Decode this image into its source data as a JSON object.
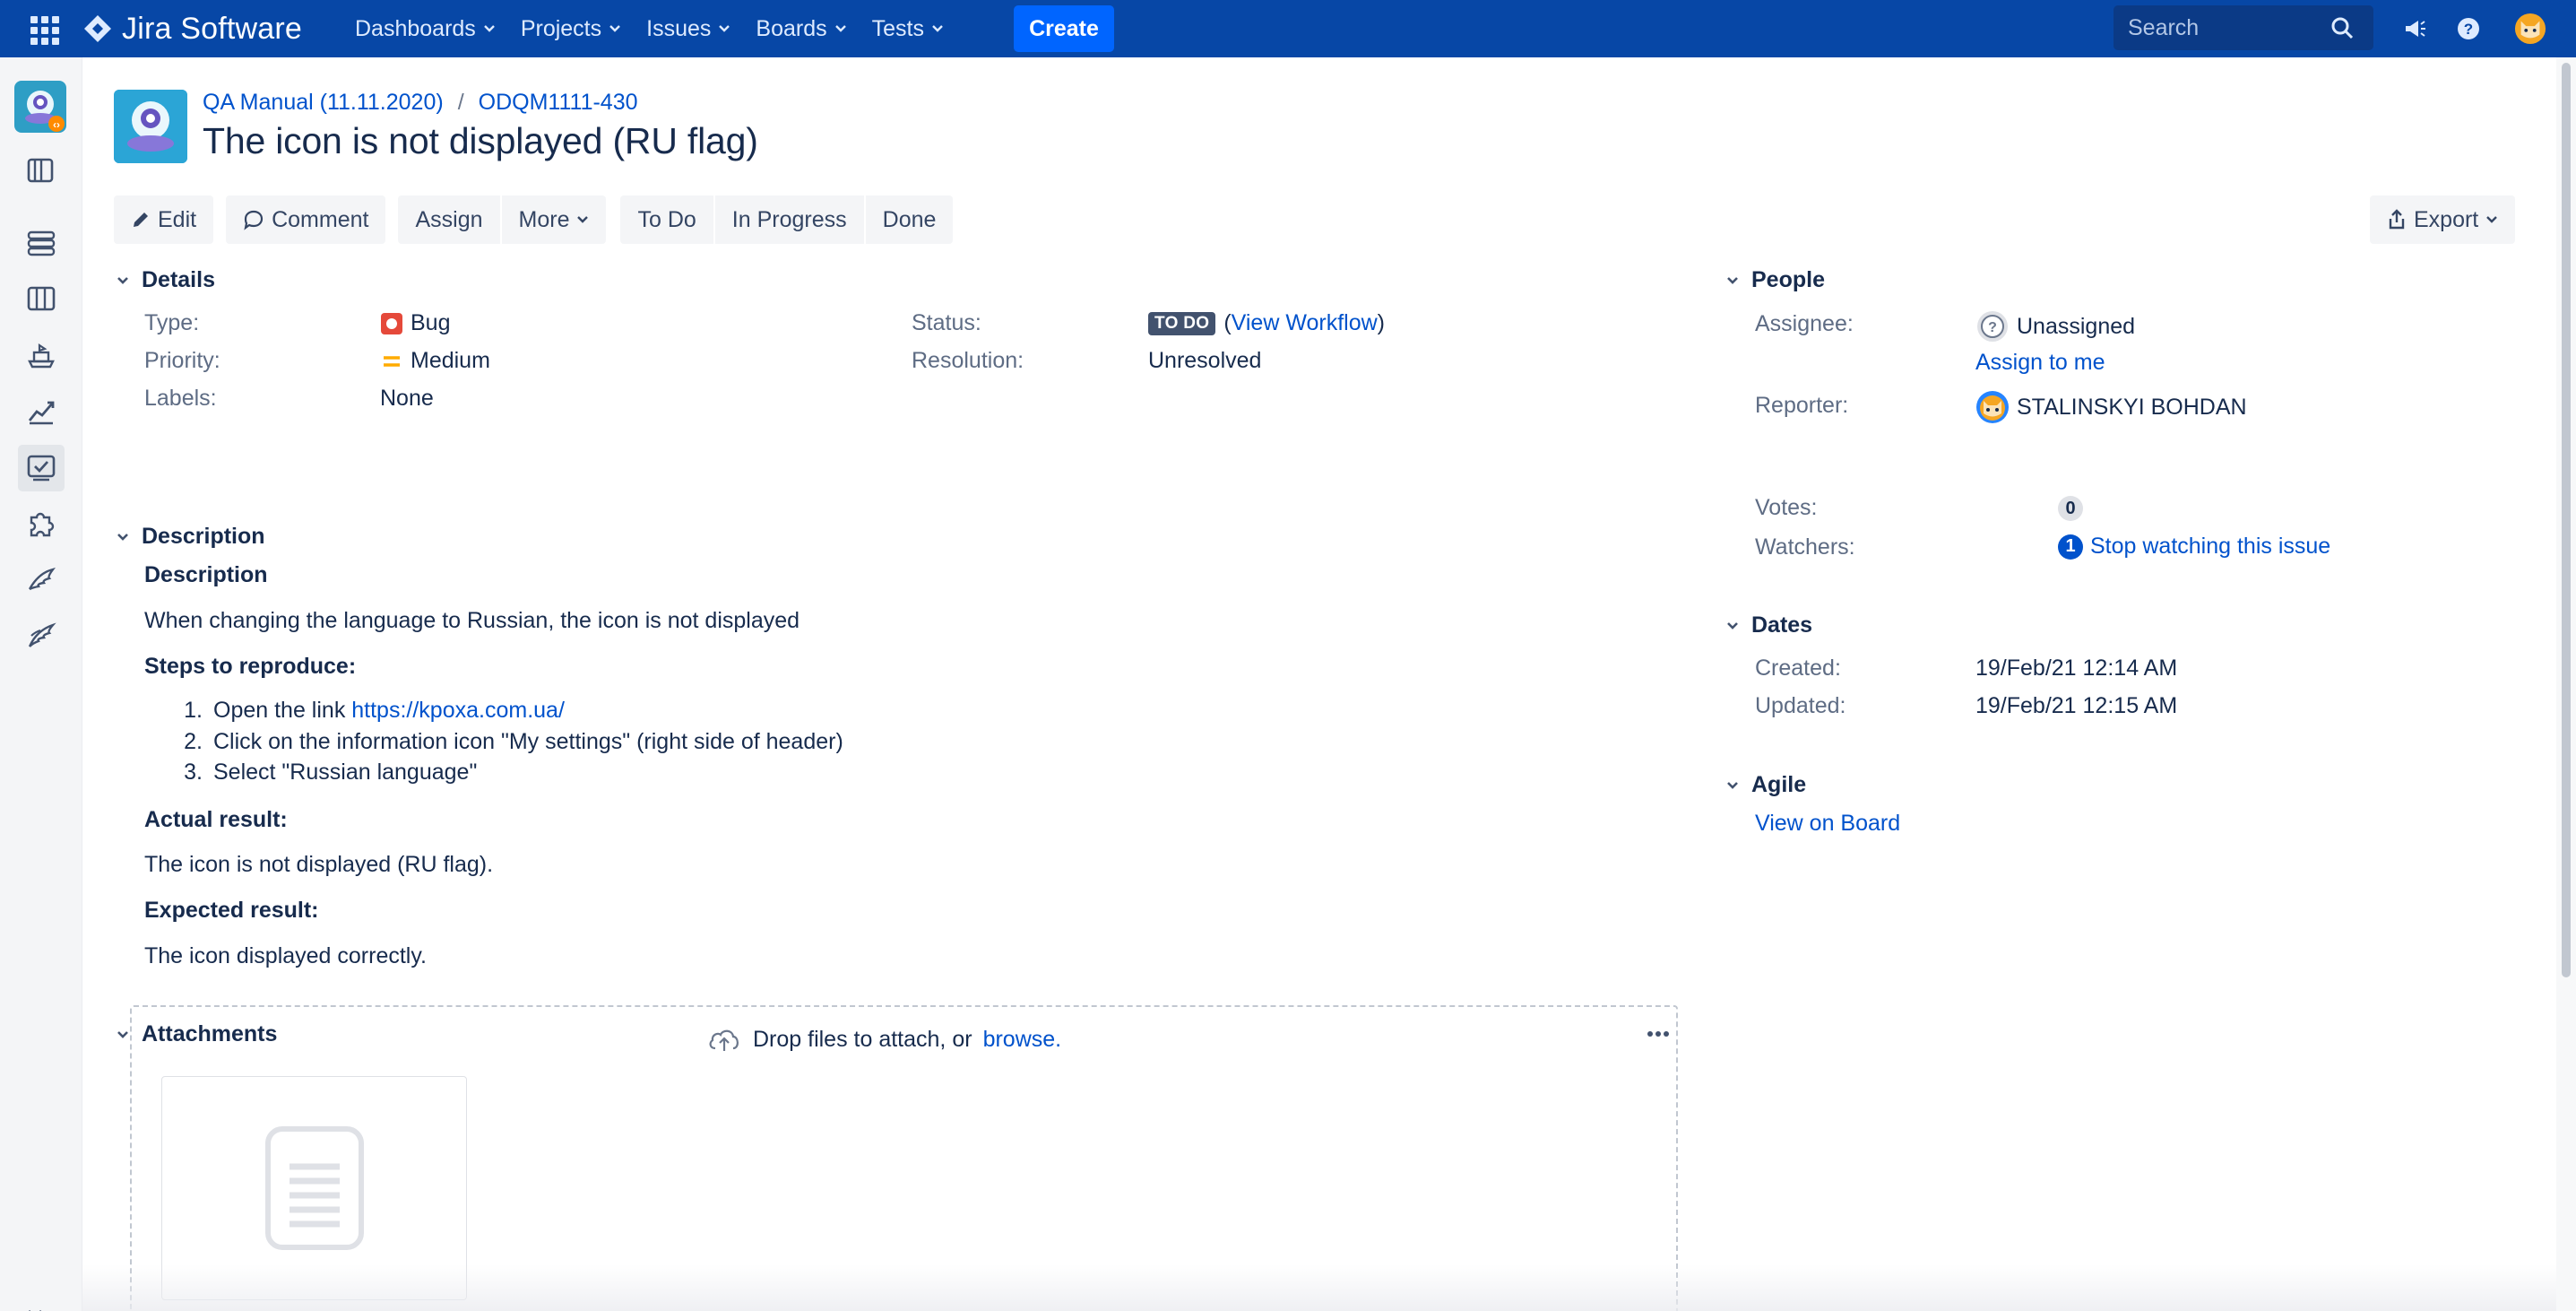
{
  "topbar": {
    "app_name": "Jira Software",
    "nav": [
      "Dashboards",
      "Projects",
      "Issues",
      "Boards",
      "Tests"
    ],
    "create_label": "Create",
    "search_placeholder": "Search"
  },
  "breadcrumb": {
    "project": "QA Manual (11.11.2020)",
    "separator": "/",
    "issue_key": "ODQM1111-430"
  },
  "issue": {
    "title": "The icon is not displayed (RU flag)"
  },
  "toolbar": {
    "edit": "Edit",
    "comment": "Comment",
    "assign": "Assign",
    "more": "More",
    "todo": "To Do",
    "in_progress": "In Progress",
    "done": "Done",
    "export": "Export"
  },
  "details": {
    "heading": "Details",
    "type_label": "Type:",
    "type_value": "Bug",
    "priority_label": "Priority:",
    "priority_value": "Medium",
    "labels_label": "Labels:",
    "labels_value": "None",
    "status_label": "Status:",
    "status_value": "TO DO",
    "status_paren_open": "(",
    "status_link": "View Workflow",
    "status_paren_close": ")",
    "resolution_label": "Resolution:",
    "resolution_value": "Unresolved"
  },
  "description": {
    "heading": "Description",
    "subheading": "Description",
    "intro": "When changing the language to Russian, the icon is not displayed",
    "steps_heading": "Steps to reproduce:",
    "steps": [
      {
        "num": "1.",
        "text": "Open the link ",
        "link": "https://kpoxa.com.ua/"
      },
      {
        "num": "2.",
        "text": "Click on the information icon \"My settings\" (right side of header)"
      },
      {
        "num": "3.",
        "text": "Select \"Russian language\""
      }
    ],
    "actual_heading": "Actual result:",
    "actual_text": "The icon is not displayed (RU flag).",
    "expected_heading": "Expected result:",
    "expected_text": "The icon displayed correctly."
  },
  "attachments": {
    "heading": "Attachments",
    "drop_text": "Drop files to attach, or",
    "browse": "browse."
  },
  "people": {
    "heading": "People",
    "assignee_label": "Assignee:",
    "assignee_value": "Unassigned",
    "assign_to_me": "Assign to me",
    "reporter_label": "Reporter:",
    "reporter_value": "STALINSKYI BOHDAN",
    "votes_label": "Votes:",
    "votes_value": "0",
    "watchers_label": "Watchers:",
    "watchers_count": "1",
    "watchers_link": "Stop watching this issue"
  },
  "dates": {
    "heading": "Dates",
    "created_label": "Created:",
    "created_value": "19/Feb/21 12:14 AM",
    "updated_label": "Updated:",
    "updated_value": "19/Feb/21 12:15 AM"
  },
  "agile": {
    "heading": "Agile",
    "view_on_board": "View on Board"
  },
  "colors": {
    "topbar": "#0747a6",
    "create": "#0065ff",
    "link": "#0052cc",
    "bug": "#e5493a",
    "priority_medium": "#ffab00",
    "status_lozenge": "#42526e"
  },
  "icons": {
    "apps": "app-switcher-icon",
    "logo": "jira-logo-icon",
    "search": "search-icon",
    "notifications": "megaphone-icon",
    "help": "help-icon",
    "profile": "user-avatar-icon"
  }
}
